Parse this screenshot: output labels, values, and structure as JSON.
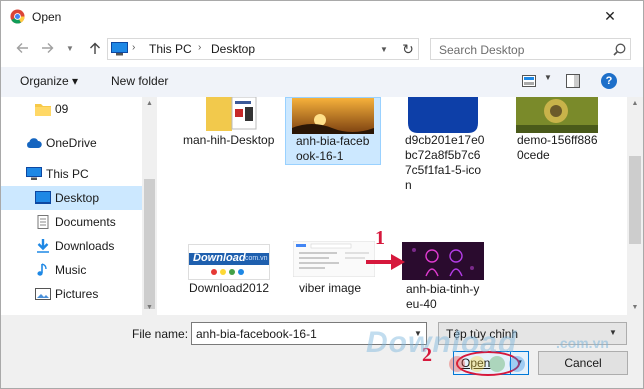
{
  "window": {
    "title": "Open",
    "close_symbol": "✕"
  },
  "address_bar": {
    "crumbs": [
      "This PC",
      "Desktop"
    ]
  },
  "search": {
    "placeholder": "Search Desktop"
  },
  "toolbar": {
    "organize_label": "Organize ▾",
    "new_folder_label": "New folder"
  },
  "sidebar": {
    "items": [
      {
        "label": "09",
        "icon": "folder-icon"
      },
      {
        "label": "OneDrive",
        "icon": "cloud-icon"
      },
      {
        "label": "This PC",
        "icon": "computer-icon"
      },
      {
        "label": "Desktop",
        "icon": "desktop-icon",
        "selected": true
      },
      {
        "label": "Documents",
        "icon": "documents-icon"
      },
      {
        "label": "Downloads",
        "icon": "downloads-icon"
      },
      {
        "label": "Music",
        "icon": "music-icon"
      },
      {
        "label": "Pictures",
        "icon": "pictures-icon"
      }
    ]
  },
  "files": [
    {
      "name": "man-hih-Desktop",
      "selected": false
    },
    {
      "name": "anh-bia-facebook-16-1",
      "selected": true
    },
    {
      "name": "d9cb201e17e0bc72a8f5b7c67c5f1fa1-5-icon",
      "selected": false
    },
    {
      "name": "demo-156ff8860cede",
      "selected": false
    },
    {
      "name": "Download2012",
      "selected": false
    },
    {
      "name": "viber image",
      "selected": false
    },
    {
      "name": "anh-bia-tinh-yeu-40",
      "selected": false
    }
  ],
  "thumb_text": {
    "download_logo": "Download",
    "download_sub": ".com.vn"
  },
  "bottom": {
    "file_name_label": "File name:",
    "file_name_value": "anh-bia-facebook-16-1",
    "file_type_value": "Tệp tùy chỉnh",
    "open_label": "Open",
    "cancel_label": "Cancel"
  },
  "annotations": {
    "step1": "1",
    "step2": "2"
  },
  "watermark": {
    "text": "Download",
    "sub": ".com.vn"
  },
  "colors": {
    "accent": "#0078d7",
    "selection": "#cce8ff",
    "annotation_red": "#d6183c"
  }
}
